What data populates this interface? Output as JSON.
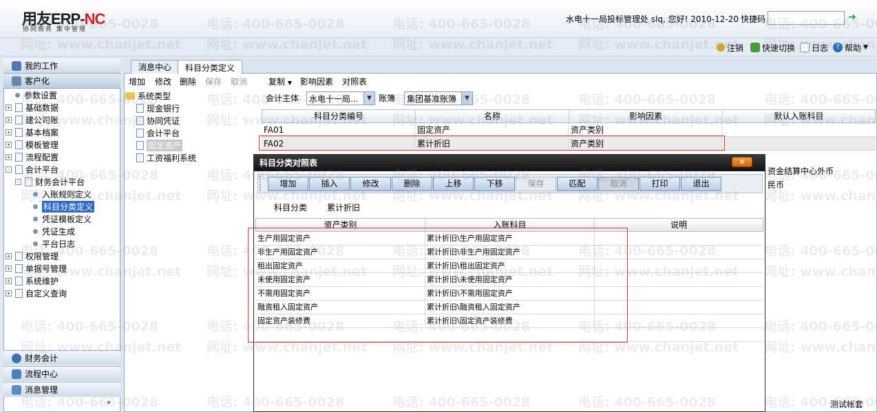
{
  "header": {
    "logo_main": "用友ERP-",
    "logo_nc": "NC",
    "logo_sub": "协同商务    集中管理",
    "user_info": "水电十一局投标管理处 slq, 您好! 2010-12-20",
    "quick_code_label": "快捷码",
    "links": {
      "logout": "注销",
      "quick_switch": "快速切换",
      "log": "日志",
      "help": "帮助"
    }
  },
  "nav": {
    "my_work": "我的工作",
    "customize": "客户化",
    "tree": [
      {
        "label": "参数设置",
        "level": 0,
        "expander": ""
      },
      {
        "label": "基础数据",
        "level": 0,
        "expander": "+"
      },
      {
        "label": "建公司账",
        "level": 0,
        "expander": "+"
      },
      {
        "label": "基本档案",
        "level": 0,
        "expander": "+"
      },
      {
        "label": "模板管理",
        "level": 0,
        "expander": "+"
      },
      {
        "label": "流程配置",
        "level": 0,
        "expander": "+"
      },
      {
        "label": "会计平台",
        "level": 0,
        "expander": "-"
      },
      {
        "label": "财务会计平台",
        "level": 1,
        "expander": "-"
      },
      {
        "label": "入账规则定义",
        "level": 2,
        "expander": ""
      },
      {
        "label": "科目分类定义",
        "level": 2,
        "expander": ""
      },
      {
        "label": "凭证模板定义",
        "level": 2,
        "expander": ""
      },
      {
        "label": "凭证生成",
        "level": 2,
        "expander": ""
      },
      {
        "label": "平台日志",
        "level": 2,
        "expander": ""
      },
      {
        "label": "权限管理",
        "level": 0,
        "expander": "+"
      },
      {
        "label": "单据号管理",
        "level": 0,
        "expander": "+"
      },
      {
        "label": "系统维护",
        "level": 0,
        "expander": "+"
      },
      {
        "label": "自定义查询",
        "level": 0,
        "expander": "+"
      }
    ],
    "bottom": [
      "财务会计",
      "流程中心",
      "消息管理"
    ]
  },
  "tabs": [
    "消息中心",
    "科目分类定义"
  ],
  "toolbar": {
    "add": "增加",
    "modify": "修改",
    "delete": "删除",
    "save": "保存",
    "cancel": "取消",
    "copy": "复制",
    "factors": "影响因素",
    "map": "对照表"
  },
  "systree": {
    "root": "系统类型",
    "items": [
      "现金银行",
      "协同凭证",
      "会计平台",
      "固定资产",
      "工资福利系统"
    ]
  },
  "filter": {
    "entity_label": "会计主体",
    "entity_value": "水电十一局...",
    "book_label": "账簿",
    "book_value": "集团基准账簿"
  },
  "grid": {
    "headers": [
      "科目分类编号",
      "名称",
      "影响因素",
      "默认入账科目"
    ],
    "rows": [
      [
        "FA01",
        "固定资产",
        "资产类别",
        ""
      ],
      [
        "FA02",
        "累计折旧",
        "资产类别",
        ""
      ],
      [
        "",
        "",
        "",
        "资金结算中心外币"
      ],
      [
        "",
        "",
        "",
        "民币"
      ]
    ]
  },
  "dialog": {
    "title": "科目分类对照表",
    "close": "✕",
    "buttons": [
      "增加",
      "插入",
      "修改",
      "删除",
      "上移",
      "下移",
      "保存",
      "匹配",
      "取消",
      "打印",
      "退出"
    ],
    "category_label": "科目分类",
    "category_value": "累计折旧",
    "headers": [
      "资产类别",
      "入账科目",
      "说明"
    ],
    "rows": [
      [
        "生产用固定资产",
        "累计折旧\\生产用固定资产",
        ""
      ],
      [
        "非生产用固定资产",
        "累计折旧\\非生产用固定资产",
        ""
      ],
      [
        "租出固定资产",
        "累计折旧\\租出固定资产",
        ""
      ],
      [
        "未使用固定资产",
        "累计折旧\\未使用固定资产",
        ""
      ],
      [
        "不需用固定资产",
        "累计折旧\\不需用固定资产",
        ""
      ],
      [
        "融资租入固定资产",
        "累计折旧\\融资租入固定资产",
        ""
      ],
      [
        "固定资产装修费",
        "累计折旧\\固定资产装修费",
        ""
      ]
    ]
  },
  "watermark": {
    "phone": "电话: 400-665-0028",
    "site": "网址: www.chanjet.net"
  },
  "status": "测试帐套"
}
